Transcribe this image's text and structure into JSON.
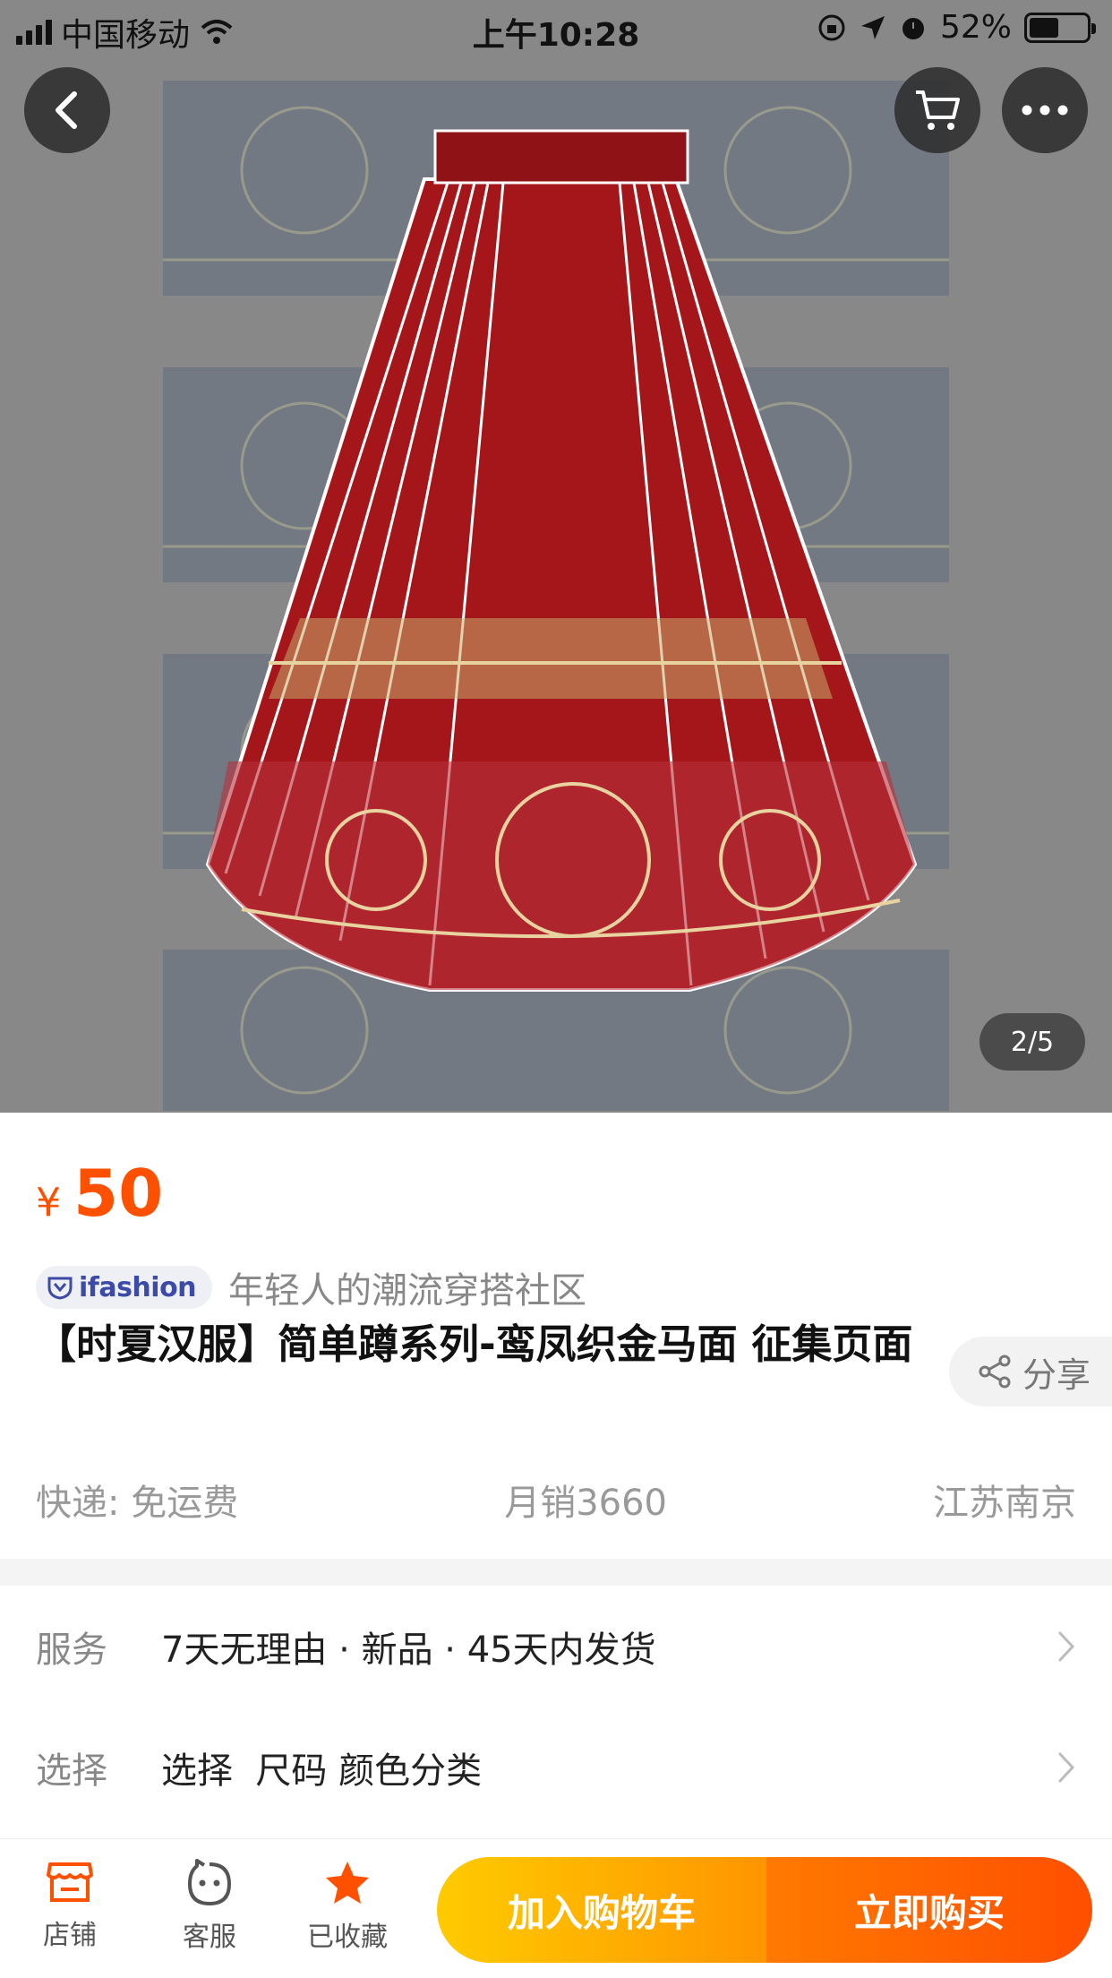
{
  "status_bar": {
    "carrier": "中国移动",
    "time": "上午10:28",
    "battery": "52%",
    "battery_level": 0.52
  },
  "hero": {
    "page_indicator": "2/5"
  },
  "product": {
    "price_symbol": "¥",
    "price": "50",
    "ifashion_brand": "ifashion",
    "ifashion_tagline": "年轻人的潮流穿搭社区",
    "title": "【时夏汉服】简单蹲系列-鸾凤织金马面 征集页面",
    "share_label": "分享",
    "shipping": "快递: 免运费",
    "monthly_sales": "月销3660",
    "location": "江苏南京"
  },
  "options": {
    "service_label": "服务",
    "service_value": "7天无理由 · 新品 · 45天内发货",
    "select_label": "选择",
    "select_value": "选择  尺码 颜色分类"
  },
  "bottom_bar": {
    "store_label": "店铺",
    "service_label": "客服",
    "favorite_label": "已收藏",
    "add_to_cart": "加入购物车",
    "buy_now": "立即购买"
  },
  "colors": {
    "accent": "#ff5000",
    "favorite_star": "#ff5000",
    "skirt": "#a4161a",
    "gold": "#d9c08a"
  }
}
